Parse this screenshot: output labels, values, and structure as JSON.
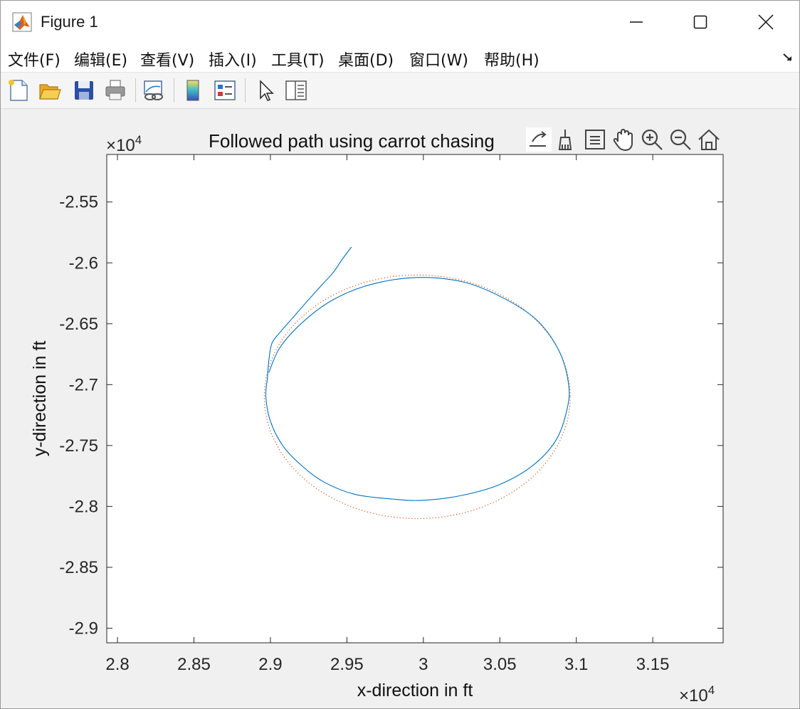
{
  "window": {
    "title": "Figure 1",
    "controls": {
      "minimize": "minimize",
      "maximize": "maximize",
      "close": "close"
    }
  },
  "menu": [
    {
      "label": "文件(F)"
    },
    {
      "label": "编辑(E)"
    },
    {
      "label": "查看(V)"
    },
    {
      "label": "插入(I)"
    },
    {
      "label": "工具(T)"
    },
    {
      "label": "桌面(D)"
    },
    {
      "label": "窗口(W)"
    },
    {
      "label": "帮助(H)"
    }
  ],
  "toolbar_icons": [
    "new-figure-icon",
    "open-icon",
    "save-icon",
    "print-icon",
    "link-plot-icon",
    "colorbar-icon",
    "legend-icon",
    "select-arrow-icon",
    "property-inspector-icon"
  ],
  "axes_toolbar_icons": [
    "export-icon",
    "brush-icon",
    "data-tips-icon",
    "pan-icon",
    "zoom-in-icon",
    "zoom-out-icon",
    "home-icon"
  ],
  "chart_data": {
    "type": "line",
    "title": "Followed path using carrot chasing",
    "xlabel": "x-direction in ft",
    "ylabel": "y-direction in ft",
    "x_multiplier": "×10",
    "x_multiplier_exp": "4",
    "y_multiplier": "×10",
    "y_multiplier_exp": "4",
    "xlim": [
      27930,
      31960
    ],
    "ylim": [
      -29120,
      -25110
    ],
    "xticks": [
      28000,
      28500,
      29000,
      29500,
      30000,
      30500,
      31000,
      31500
    ],
    "xtick_labels": [
      "2.8",
      "2.85",
      "2.9",
      "2.95",
      "3",
      "3.05",
      "3.1",
      "3.15"
    ],
    "yticks": [
      -25500,
      -26000,
      -26500,
      -27000,
      -27500,
      -28000,
      -28500,
      -29000
    ],
    "ytick_labels": [
      "-2.55",
      "-2.6",
      "-2.65",
      "-2.7",
      "-2.75",
      "-2.8",
      "-2.85",
      "-2.9"
    ],
    "grid": false,
    "series": [
      {
        "style": "dotted",
        "color": "#d95319",
        "shape": "circle",
        "center": [
          29960,
          -27100
        ],
        "radius": 1000
      },
      {
        "style": "solid",
        "color": "#0072bd",
        "points": [
          [
            29530,
            -25870
          ],
          [
            29470,
            -25970
          ],
          [
            29410,
            -26080
          ],
          [
            29330,
            -26190
          ],
          [
            29230,
            -26330
          ],
          [
            29140,
            -26460
          ],
          [
            29070,
            -26560
          ],
          [
            29010,
            -26660
          ],
          [
            28990,
            -26800
          ],
          [
            28980,
            -26950
          ],
          [
            28970,
            -27100
          ],
          [
            29000,
            -27300
          ],
          [
            29080,
            -27500
          ],
          [
            29200,
            -27660
          ],
          [
            29350,
            -27800
          ],
          [
            29550,
            -27900
          ],
          [
            29800,
            -27940
          ],
          [
            30000,
            -27950
          ],
          [
            30250,
            -27910
          ],
          [
            30500,
            -27820
          ],
          [
            30720,
            -27660
          ],
          [
            30870,
            -27450
          ],
          [
            30940,
            -27200
          ],
          [
            30950,
            -27000
          ],
          [
            30890,
            -26730
          ],
          [
            30750,
            -26480
          ],
          [
            30540,
            -26300
          ],
          [
            30270,
            -26160
          ],
          [
            29960,
            -26120
          ],
          [
            29650,
            -26180
          ],
          [
            29400,
            -26310
          ],
          [
            29200,
            -26500
          ],
          [
            29060,
            -26700
          ],
          [
            28990,
            -26900
          ]
        ]
      }
    ]
  }
}
